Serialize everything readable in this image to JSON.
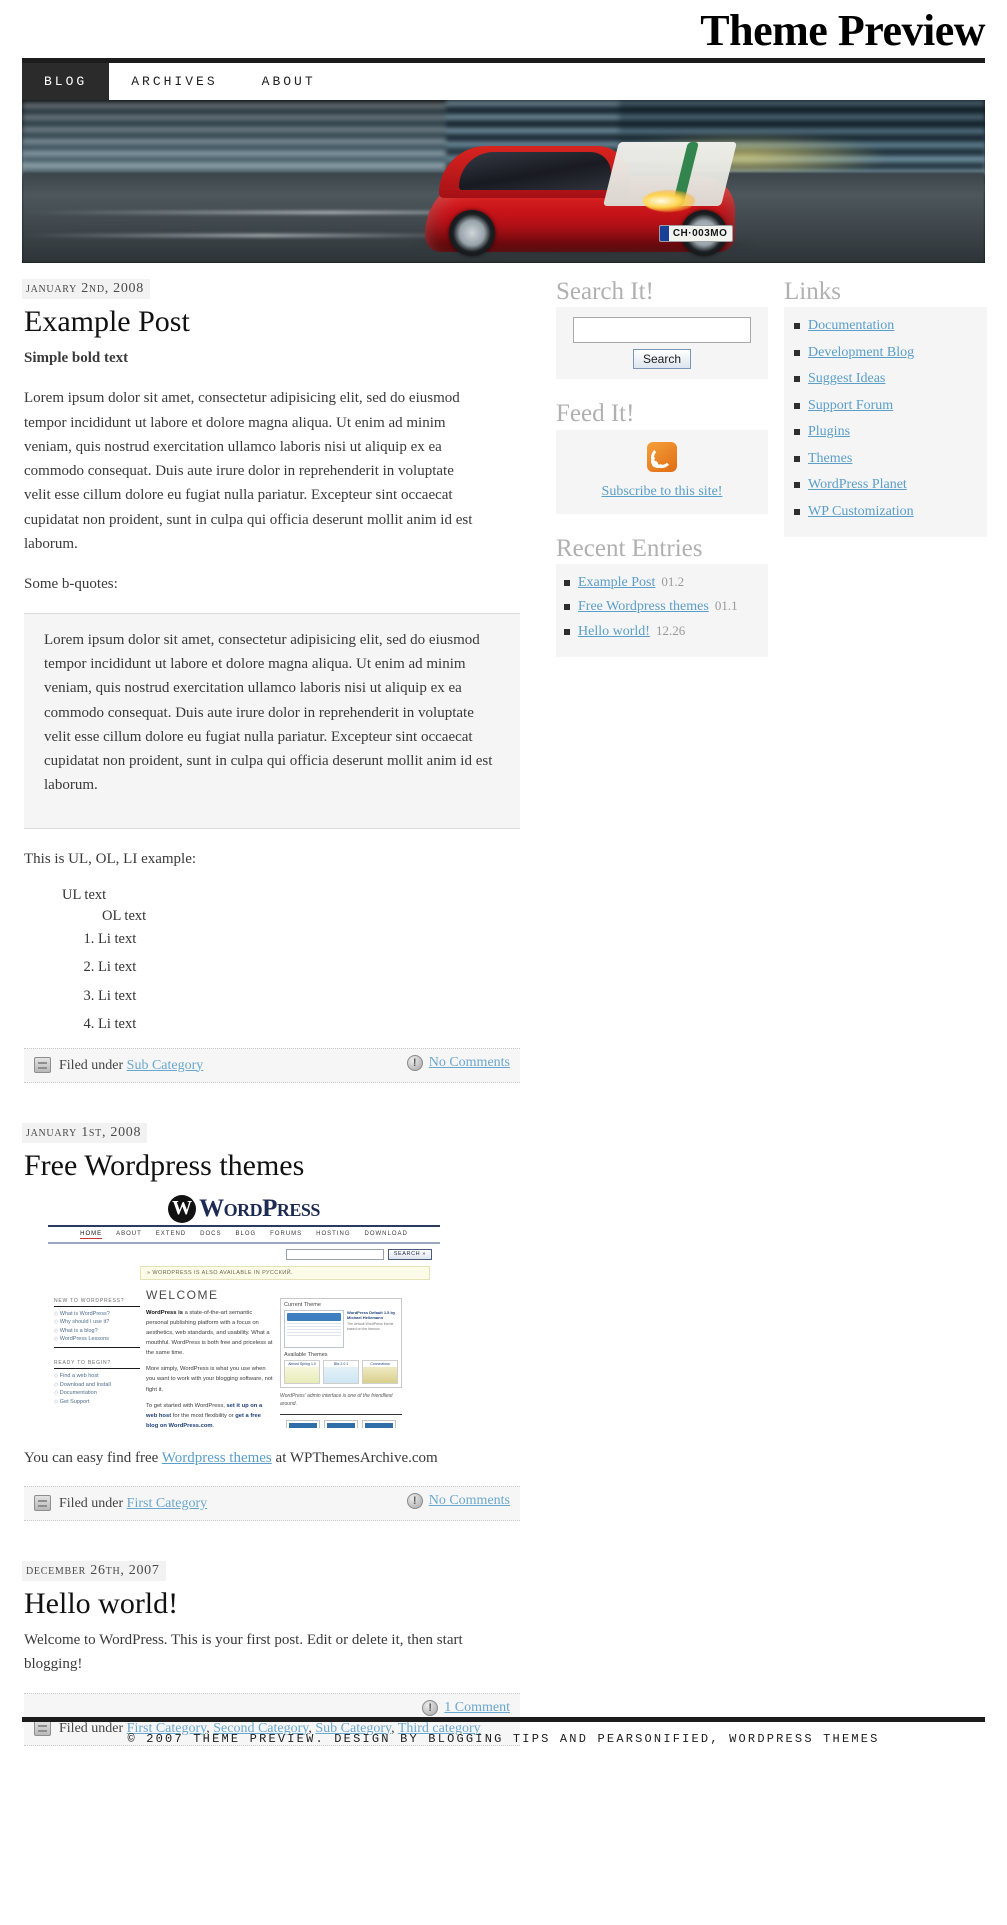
{
  "header": {
    "site_title": "Theme Preview"
  },
  "nav": {
    "items": [
      {
        "label": "Blog",
        "active": true
      },
      {
        "label": "Archives",
        "active": false
      },
      {
        "label": "About",
        "active": false
      }
    ]
  },
  "banner": {
    "alt": "Red Ferrari sports car speeding on a road with motion blur",
    "license_plate": "CH·003MO",
    "plate_region": ""
  },
  "posts": [
    {
      "date": "January 2nd, 2008",
      "title": "Example Post",
      "bold_intro": "Simple bold text",
      "paragraph": "Lorem ipsum dolor sit amet, consectetur adipisicing elit, sed do eiusmod tempor incididunt ut labore et dolore magna aliqua. Ut enim ad minim veniam, quis nostrud exercitation ullamco laboris nisi ut aliquip ex ea commodo consequat. Duis aute irure dolor in reprehenderit in voluptate velit esse cillum dolore eu fugiat nulla pariatur. Excepteur sint occaecat cupidatat non proident, sunt in culpa qui officia deserunt mollit anim id est laborum.",
      "quote_lead": "Some b-quotes:",
      "blockquote": "Lorem ipsum dolor sit amet, consectetur adipisicing elit, sed do eiusmod tempor incididunt ut labore et dolore magna aliqua. Ut enim ad minim veniam, quis nostrud exercitation ullamco laboris nisi ut aliquip ex ea commodo consequat. Duis aute irure dolor in reprehenderit in voluptate velit esse cillum dolore eu fugiat nulla pariatur. Excepteur sint occaecat cupidatat non proident, sunt in culpa qui officia deserunt mollit anim id est laborum.",
      "list_lead": "This is UL, OL, LI example:",
      "ul_text": "UL text",
      "ol_text": "OL text",
      "li_items": [
        "Li text",
        "Li text",
        "Li text",
        "Li text"
      ],
      "filed_under_label": "Filed under",
      "categories": [
        "Sub Category"
      ],
      "comments_label": "No Comments"
    },
    {
      "date": "January 1st, 2008",
      "title": "Free Wordpress themes",
      "caption_before": "You can easy find free ",
      "caption_link": "Wordpress themes",
      "caption_after": " at WPThemesArchive.com",
      "filed_under_label": "Filed under",
      "categories": [
        "First Category"
      ],
      "comments_label": "No Comments"
    },
    {
      "date": "December 26th, 2007",
      "title": "Hello world!",
      "paragraph": "Welcome to WordPress. This is your first post. Edit or delete it, then start blogging!",
      "filed_under_label": "Filed under",
      "categories": [
        "First Category",
        "Second Category",
        "Sub Category",
        "Third category"
      ],
      "comments_label": "1 Comment"
    }
  ],
  "wp_screenshot": {
    "logo_mark": "W",
    "logo_word": "WordPress",
    "nav": [
      "HOME",
      "ABOUT",
      "EXTEND",
      "DOCS",
      "BLOG",
      "FORUMS",
      "HOSTING",
      "DOWNLOAD"
    ],
    "search_button": "SEARCH »",
    "notice": "» WORDPRESS IS ALSO AVAILABLE IN РУССКИЙ.",
    "welcome_heading": "WELCOME",
    "para1_bold": "WordPress is",
    "para1_rest": " a state-of-the-art semantic personal publishing platform with a focus on aesthetics, web standards, and usability. What a mouthful. WordPress is both free and priceless at the same time.",
    "para2": "More simply, WordPress is what you use when you want to work with your blogging software, not fight it.",
    "para3_before": "To get started with WordPress, ",
    "para3_link1": "set it up on a web host",
    "para3_mid": " for the most flexibility or ",
    "para3_link2": "get a free blog on WordPress.com",
    "para3_end": ".",
    "left_head1": "NEW TO WORDPRESS?",
    "left_items1": [
      "What is WordPress?",
      "Why should I use it?",
      "What is a blog?",
      "WordPress Lessons"
    ],
    "left_head2": "READY TO BEGIN?",
    "left_items2": [
      "Find a web host",
      "Download and Install",
      "Documentation",
      "Get Support"
    ],
    "panel_title": "Current Theme",
    "panel_text_title": "WordPress Default 1.5 by Michael Heilemann",
    "panel_text_body": "The default WordPress theme based on the famous",
    "available_themes": "Available Themes",
    "theme_names": [
      "Almost Spring 1.0",
      "Blix 2.0.1",
      "Connections"
    ],
    "caption": "WordPress' admin interface is one of the friendliest around."
  },
  "sidebar": {
    "search_widget": {
      "title": "Search It!",
      "input_value": "",
      "input_placeholder": "",
      "button_label": "Search"
    },
    "feed_widget": {
      "title": "Feed It!",
      "icon": "rss-icon",
      "link_label": "Subscribe to this site!"
    },
    "recent_widget": {
      "title": "Recent Entries",
      "items": [
        {
          "label": "Example Post",
          "date": "01.2"
        },
        {
          "label": "Free Wordpress themes",
          "date": "01.1"
        },
        {
          "label": "Hello world!",
          "date": "12.26"
        }
      ]
    },
    "links_widget": {
      "title": "Links",
      "items": [
        "Documentation",
        "Development Blog",
        "Suggest Ideas",
        "Support Forum",
        "Plugins",
        "Themes",
        "WordPress Planet",
        "WP Customization"
      ]
    }
  },
  "footer": {
    "text": "© 2007 Theme Preview. Design by Blogging Tips and Pearsonified, WordPress Themes"
  }
}
